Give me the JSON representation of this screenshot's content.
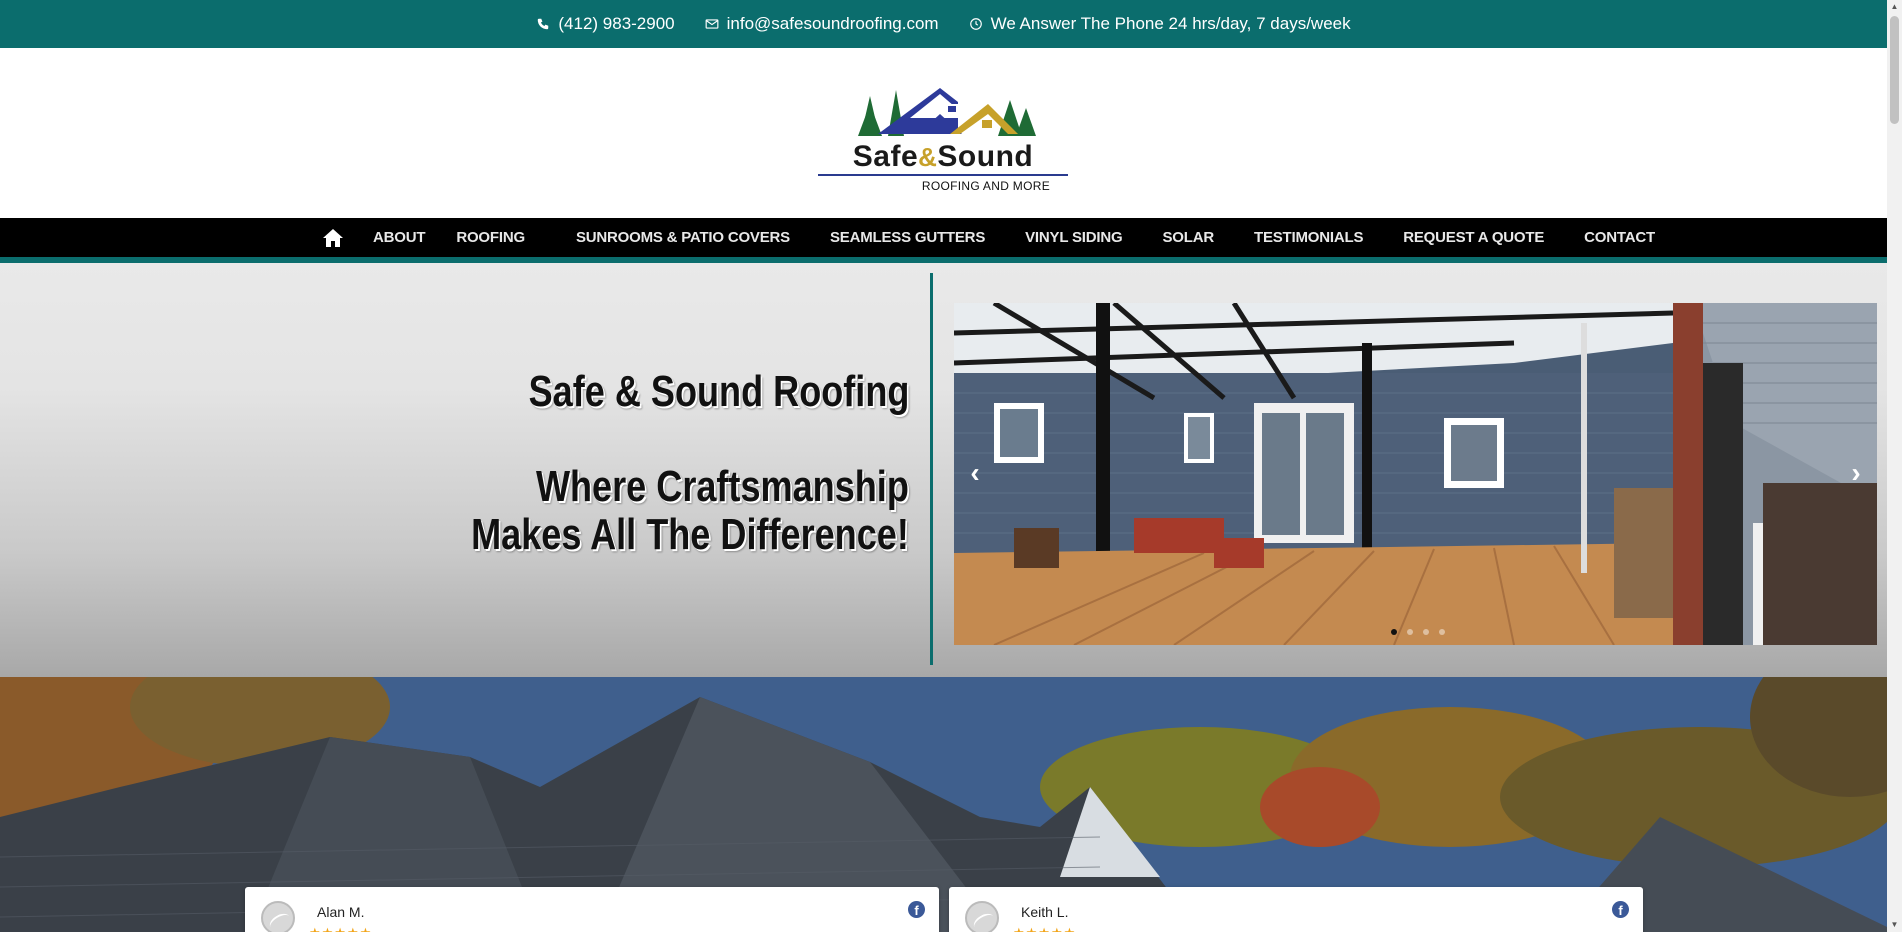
{
  "topbar": {
    "phone": "(412) 983-2900",
    "email": "info@safesoundroofing.com",
    "hours": "We Answer The Phone 24 hrs/day, 7 days/week"
  },
  "logo": {
    "brand_left": "Safe",
    "brand_amp": "&",
    "brand_right": "Sound",
    "tagline": "ROOFING AND MORE"
  },
  "nav": {
    "items": [
      {
        "label": "ABOUT"
      },
      {
        "label": "ROOFING"
      },
      {
        "label": "SUNROOMS & PATIO COVERS"
      },
      {
        "label": "SEAMLESS GUTTERS"
      },
      {
        "label": "VINYL SIDING"
      },
      {
        "label": "SOLAR"
      },
      {
        "label": "TESTIMONIALS"
      },
      {
        "label": "REQUEST A QUOTE"
      },
      {
        "label": "CONTACT"
      }
    ]
  },
  "hero": {
    "title": "Safe & Sound Roofing",
    "subtitle_line1": "Where Craftsmanship",
    "subtitle_line2": "Makes All The Difference!"
  },
  "slider": {
    "prev_glyph": "‹",
    "next_glyph": "›",
    "active_index": 0
  },
  "reviews": [
    {
      "name": "Alan M.",
      "stars": "★★★★★",
      "source_glyph": "f"
    },
    {
      "name": "Keith L.",
      "stars": "★★★★★",
      "source_glyph": "f"
    }
  ],
  "colors": {
    "accent": "#0b6d6d",
    "nav_bg": "#000000",
    "star": "#f2a51a",
    "facebook": "#3b5998"
  }
}
